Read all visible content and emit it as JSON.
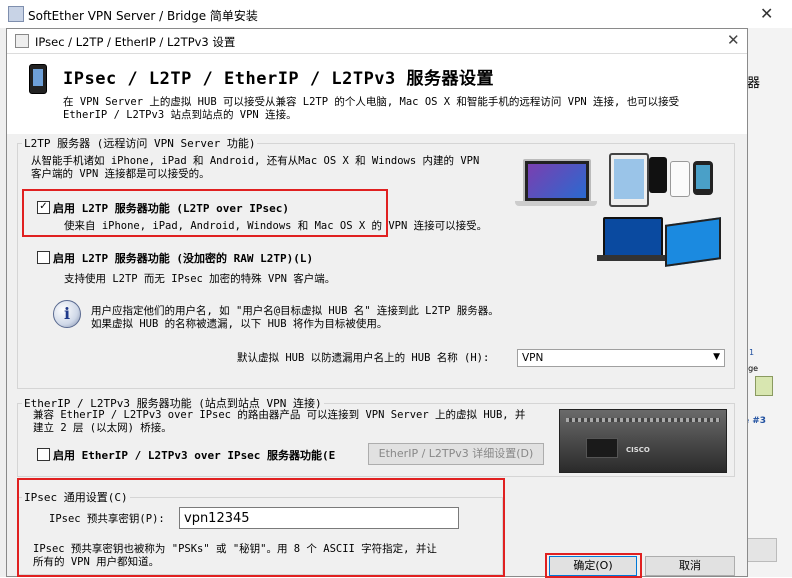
{
  "outer_window": {
    "title": "SoftEther VPN Server / Bridge 简单安装"
  },
  "background_fragments": {
    "right_top": "器",
    "right_label_a": "1",
    "right_label_b": "dge",
    "right_label_c": "e #3"
  },
  "dialog": {
    "title": "IPsec / L2TP / EtherIP / L2TPv3 设置",
    "header_title": "IPsec / L2TP / EtherIP / L2TPv3 服务器设置",
    "intro_line1": "在 VPN Server 上的虚拟 HUB 可以接受从兼容 L2TP 的个人电脑, Mac OS X 和智能手机的远程访问 VPN 连接, 也可以接受",
    "intro_line2": "EtherIP / L2TPv3 站点到站点的 VPN 连接。",
    "l2tp_group": {
      "legend": "L2TP 服务器 (远程访问 VPN Server 功能)",
      "desc_line1": "从智能手机诸如 iPhone, iPad 和 Android, 还有从Mac OS X 和 Windows 内建的 VPN",
      "desc_line2": "客户端的 VPN 连接都是可以接受的。",
      "enable_l2tp_ipsec": {
        "checked": true,
        "label": "启用 L2TP 服务器功能 (L2TP over IPsec)"
      },
      "enable_l2tp_ipsec_desc": "使来自 iPhone, iPad, Android, Windows 和 Mac OS X 的 VPN 连接可以接受。",
      "enable_raw_l2tp": {
        "checked": false,
        "label": "启用 L2TP 服务器功能 (没加密的 RAW L2TP)(L)"
      },
      "raw_l2tp_desc": "支持使用 L2TP 而无 IPsec 加密的特殊 VPN 客户端。",
      "info_line1": "用户应指定他们的用户名, 如 \"用户名@目标虚拟 HUB 名\" 连接到此 L2TP 服务器。",
      "info_line2": "如果虚拟 HUB 的名称被遗漏, 以下 HUB 将作为目标被使用。",
      "default_hub_label": "默认虚拟 HUB 以防遗漏用户名上的 HUB 名称 (H):",
      "default_hub_value": "VPN"
    },
    "etherip_group": {
      "legend": "EtherIP / L2TPv3 服务器功能 (站点到站点 VPN 连接)",
      "desc_line1": "兼容 EtherIP / L2TPv3 over IPsec 的路由器产品 可以连接到 VPN Server 上的虚拟 HUB, 并",
      "desc_line2": "建立 2 层 (以太网) 桥接。",
      "enable_etherip": {
        "checked": false,
        "label": "启用 EtherIP / L2TPv3 over IPsec 服务器功能(E"
      },
      "detail_button": "EtherIP / L2TPv3 详细设置(D)",
      "router_brand": "CISCO"
    },
    "ipsec_group": {
      "legend": "IPsec 通用设置(C)",
      "psk_label": "IPsec 预共享密钥(P):",
      "psk_value": "vpn12345",
      "note_line1": "IPsec 预共享密钥也被称为 \"PSKs\" 或 \"秘钥\"。用 8 个 ASCII 字符指定, 并让",
      "note_line2": "所有的 VPN 用户都知道。"
    },
    "ok_button": "确定(O)",
    "cancel_button": "取消"
  },
  "colors": {
    "highlight_red": "#e02020",
    "dialog_bg": "#f0f0f0"
  }
}
